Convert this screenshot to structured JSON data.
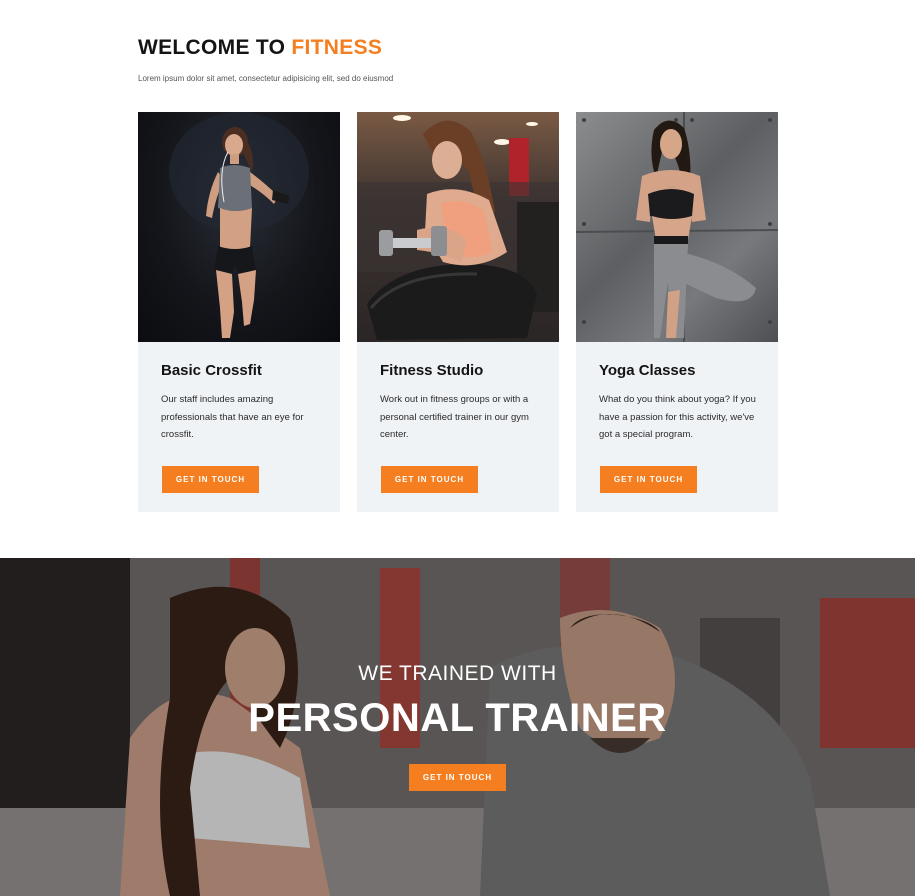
{
  "welcome": {
    "title_prefix": "WELCOME TO",
    "title_accent": "FITNESS",
    "subtitle": "Lorem ipsum dolor sit amet, consectetur adipisicing elit, sed do eiusmod"
  },
  "cards": [
    {
      "title": "Basic Crossfit",
      "text": "Our staff includes amazing professionals that have an eye for crossfit.",
      "button": "GET IN TOUCH"
    },
    {
      "title": "Fitness Studio",
      "text": "Work out in fitness groups or with a personal certified trainer in our gym center.",
      "button": "GET IN TOUCH"
    },
    {
      "title": "Yoga Classes",
      "text": "What do you think about yoga? If you have a passion for this activity, we've got a special program.",
      "button": "GET IN TOUCH"
    }
  ],
  "hero": {
    "subtitle": "WE TRAINED WITH",
    "title": "PERSONAL TRAINER",
    "button": "GET IN TOUCH"
  },
  "colors": {
    "accent": "#f57f20",
    "card_bg": "#f0f3f6"
  }
}
